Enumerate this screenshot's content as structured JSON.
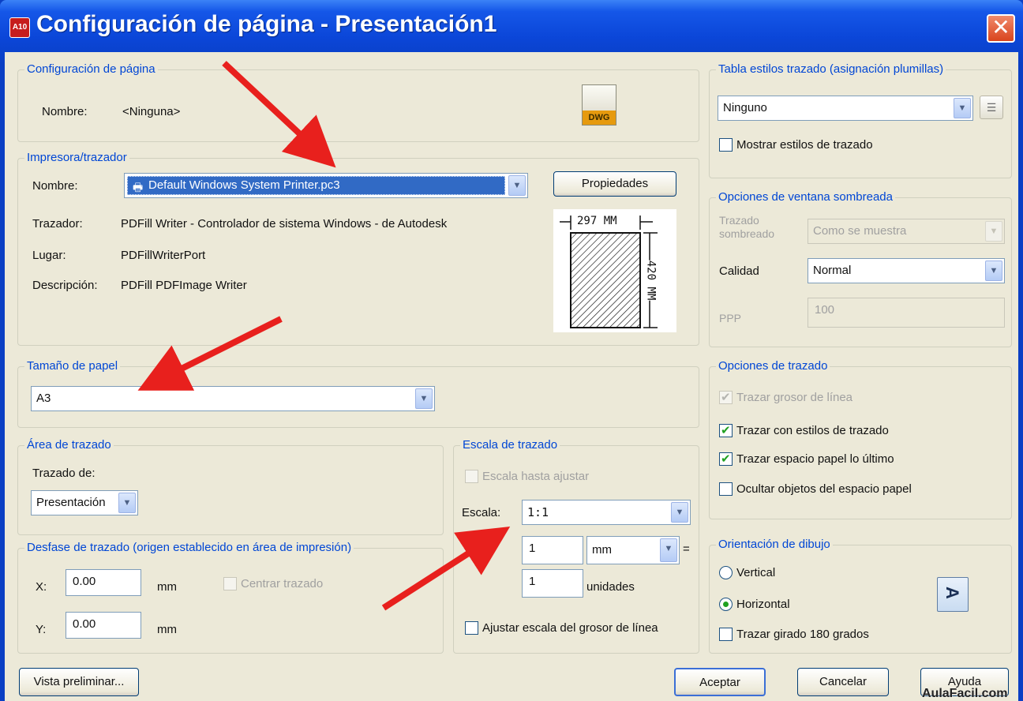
{
  "window": {
    "title": "Configuración de página - Presentación1",
    "app_icon_text": "A10",
    "close_symbol": "✕"
  },
  "config_pagina": {
    "title": "Configuración de página",
    "name_label": "Nombre:",
    "name_value": "<Ninguna>",
    "file_icon_text": "DWG"
  },
  "impresora": {
    "title": "Impresora/trazador",
    "name_label": "Nombre:",
    "printer_value": "Default Windows System Printer.pc3",
    "properties_button": "Propiedades",
    "trazador_label": "Trazador:",
    "trazador_value": "PDFill Writer - Controlador de sistema Windows - de Autodesk",
    "lugar_label": "Lugar:",
    "lugar_value": "PDFillWriterPort",
    "descripcion_label": "Descripción:",
    "descripcion_value": "PDFill PDFImage Writer",
    "paper_width_label": "297 MM",
    "paper_height_label": "420 MM"
  },
  "tamano_papel": {
    "title": "Tamaño de papel",
    "value": "A3"
  },
  "area_trazado": {
    "title": "Área de trazado",
    "trazado_de_label": "Trazado de:",
    "value": "Presentación"
  },
  "desfase": {
    "title": "Desfase de trazado (origen establecido en área de impresión)",
    "x_label": "X:",
    "x_value": "0.00",
    "x_unit": "mm",
    "y_label": "Y:",
    "y_value": "0.00",
    "y_unit": "mm",
    "centrar_label": "Centrar trazado",
    "centrar_checked": false
  },
  "escala": {
    "title": "Escala de trazado",
    "ajustar_label": "Escala hasta ajustar",
    "escala_label": "Escala:",
    "escala_value": "1:1",
    "num_value": "1",
    "unit_value": "mm",
    "equals": "=",
    "units_value": "1",
    "units_label": "unidades",
    "grosor_label": "Ajustar escala del grosor de línea"
  },
  "estilos": {
    "title": "Tabla estilos trazado (asignación plumillas)",
    "value": "Ninguno",
    "mostrar_label": "Mostrar estilos de trazado"
  },
  "sombreada": {
    "title": "Opciones de ventana sombreada",
    "trazado_label": "Trazado sombreado",
    "trazado_value": "Como se muestra",
    "calidad_label": "Calidad",
    "calidad_value": "Normal",
    "ppp_label": "PPP",
    "ppp_value": "100"
  },
  "opciones": {
    "title": "Opciones de trazado",
    "grosor_label": "Trazar grosor de línea",
    "estilos_label": "Trazar con estilos de trazado",
    "papel_label": "Trazar espacio papel lo último",
    "ocultar_label": "Ocultar objetos del espacio papel"
  },
  "orientacion": {
    "title": "Orientación de dibujo",
    "vertical_label": "Vertical",
    "horizontal_label": "Horizontal",
    "girado_label": "Trazar girado 180 grados",
    "selected": "Horizontal",
    "preview_glyph": "A"
  },
  "buttons": {
    "preview": "Vista preliminar...",
    "accept": "Aceptar",
    "cancel": "Cancelar",
    "help": "Ayuda"
  },
  "watermark": "AulaFacil.com",
  "colors": {
    "title_bar": "#0a3fc4",
    "group_title": "#0046d5",
    "annotation_arrow": "#e8201d",
    "check_green": "#21a121"
  }
}
